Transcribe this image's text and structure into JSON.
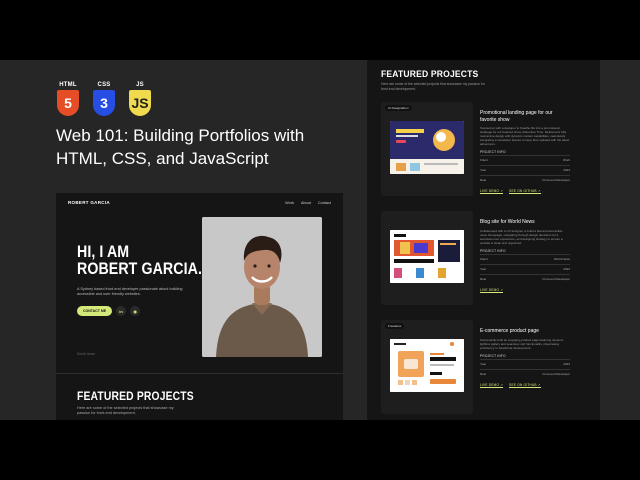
{
  "course": {
    "badges": [
      {
        "label": "HTML",
        "glyph": "5",
        "color": "#e44d26"
      },
      {
        "label": "CSS",
        "glyph": "3",
        "color": "#264de4"
      },
      {
        "label": "JS",
        "glyph": "JS",
        "color": "#f0db4f"
      }
    ],
    "title": "Web 101: Building Portfolios with HTML, CSS, and JavaScript"
  },
  "site": {
    "logo": "ROBERT GARCIA",
    "nav": [
      "Work",
      "About",
      "Contact"
    ],
    "hero_line1": "HI, I AM",
    "hero_line2": "ROBERT GARCIA.",
    "hero_description": "A Sydney based front-end developer passionate about building accessible and user friendly websites.",
    "contact_label": "CONTACT ME",
    "linkedin_icon_text": "in",
    "github_icon_text": "◉",
    "scroll_hint": "Scroll down",
    "featured_title": "FEATURED PROJECTS",
    "featured_description": "Here are some of the selected projects that showcase my passion for front-end development."
  },
  "projects_page": {
    "title": "FEATURED PROJECTS",
    "description": "Here are some of the selected projects that showcase my passion for front-end development.",
    "projects": [
      {
        "tag": "Ui Designathon",
        "title": "Promotional landing page for our favorite show",
        "description": "Teamed up with a designer to breathe life into a promotional webpage for our beloved show, Adventure Time. Delivered a fully responsive design with dynamic content capabilities, seamlessly integrating a newsletter feature to keep fans updated with the latest adventures.",
        "info_label": "PROJECT INFO",
        "rows": [
          [
            "Client",
            "Work"
          ],
          [
            "Year",
            "2023"
          ],
          [
            "Role",
            "Front-end Developer"
          ]
        ],
        "links": [
          "LIVE DEMO ↗",
          "SEE ON GITHUB ↗"
        ]
      },
      {
        "tag": "",
        "title": "Blog site for World News",
        "description": "Collaborated with a UX designer to build a fast and accessible news homepage, navigating through design decisions for a seamless user experience, and designing strategy to ensure a website is clean and organized.",
        "info_label": "PROJECT INFO",
        "rows": [
          [
            "Client",
            "World News"
          ],
          [
            "Year",
            "2022"
          ],
          [
            "Role",
            "Front-end Developer"
          ]
        ],
        "links": [
          "LIVE DEMO ↗"
        ]
      },
      {
        "tag": "Freelance",
        "title": "E-commerce product page",
        "description": "Successfully built an engaging product page featuring dynamic lightbox gallery and seamless cart functionality, showcasing proficiency in JavaScript development.",
        "info_label": "PROJECT INFO",
        "rows": [
          [
            "Year",
            "2022"
          ],
          [
            "Role",
            "Front-end Developer"
          ]
        ],
        "links": [
          "LIVE DEMO ↗",
          "SEE ON GITHUB ↗"
        ]
      }
    ]
  },
  "colors": {
    "accent": "#d3e97a",
    "background": "#262626",
    "panel": "#151515"
  }
}
